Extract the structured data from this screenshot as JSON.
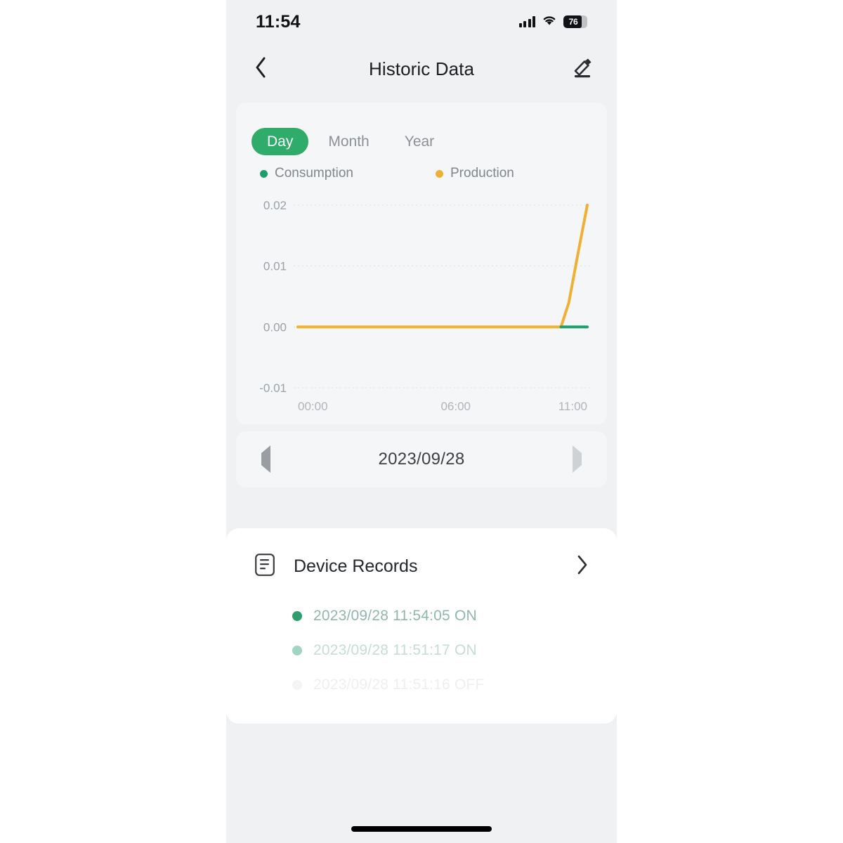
{
  "status_bar": {
    "time": "11:54",
    "battery_percent": "76",
    "icons": [
      "signal-bars-icon",
      "wifi-icon",
      "battery-icon"
    ]
  },
  "nav": {
    "back_icon": "chevron-left-icon",
    "title": "Historic Data",
    "edit_icon": "pencil-edit-icon"
  },
  "chart_card": {
    "tabs": [
      {
        "label": "Day",
        "active": true
      },
      {
        "label": "Month",
        "active": false
      },
      {
        "label": "Year",
        "active": false
      }
    ],
    "legend": [
      {
        "label": "Consumption",
        "color": "#1e9e6a"
      },
      {
        "label": "Production",
        "color": "#efb033"
      }
    ]
  },
  "chart_data": {
    "type": "line",
    "title": "",
    "xlabel": "",
    "ylabel": "",
    "ylim": [
      -0.01,
      0.02
    ],
    "xlim": [
      "00:00",
      "11:00"
    ],
    "ytick_labels": [
      "0.02",
      "0.01",
      "0.00",
      "-0.01"
    ],
    "ytick_values": [
      0.02,
      0.01,
      0.0,
      -0.01
    ],
    "xtick_labels": [
      "00:00",
      "06:00",
      "11:00"
    ],
    "xtick_values": [
      0,
      6,
      11
    ],
    "grid": true,
    "legend_position": "top",
    "series": [
      {
        "name": "Production",
        "color": "#efb033",
        "x": [
          0,
          1,
          2,
          3,
          4,
          5,
          6,
          7,
          8,
          9,
          10,
          10.3,
          10.6,
          11
        ],
        "values": [
          0,
          0,
          0,
          0,
          0,
          0,
          0,
          0,
          0,
          0,
          0,
          0.004,
          0.011,
          0.02
        ]
      },
      {
        "name": "Consumption",
        "color": "#1e9e6a",
        "x": [
          10,
          10.5,
          11
        ],
        "values": [
          0,
          0,
          0
        ]
      }
    ]
  },
  "date_nav": {
    "prev_icon": "triangle-left-icon",
    "date": "2023/09/28",
    "next_icon": "triangle-right-icon"
  },
  "records": {
    "icon": "document-list-icon",
    "title": "Device Records",
    "chevron_icon": "chevron-right-icon",
    "items": [
      {
        "text": "2023/09/28 11:54:05 ON",
        "dot_color": "#2f9e6e",
        "opacity": 1.0,
        "text_color": "#8fb8ab"
      },
      {
        "text": "2023/09/28 11:51:17 ON",
        "dot_color": "#6cbb9c",
        "opacity": 0.62,
        "text_color": "#a8c7bd"
      },
      {
        "text": "2023/09/28 11:51:16 OFF",
        "dot_color": "#d9dcde",
        "opacity": 0.3,
        "text_color": "#c9cdd0"
      }
    ]
  },
  "home_indicator": "home-indicator-bar",
  "colors": {
    "accent_green": "#2fab6a",
    "production_yellow": "#efb033",
    "consumption_green": "#1e9e6a",
    "page_background": "#eff1f2",
    "card_background": "#f5f6f7",
    "sheet_background": "#ffffff"
  }
}
